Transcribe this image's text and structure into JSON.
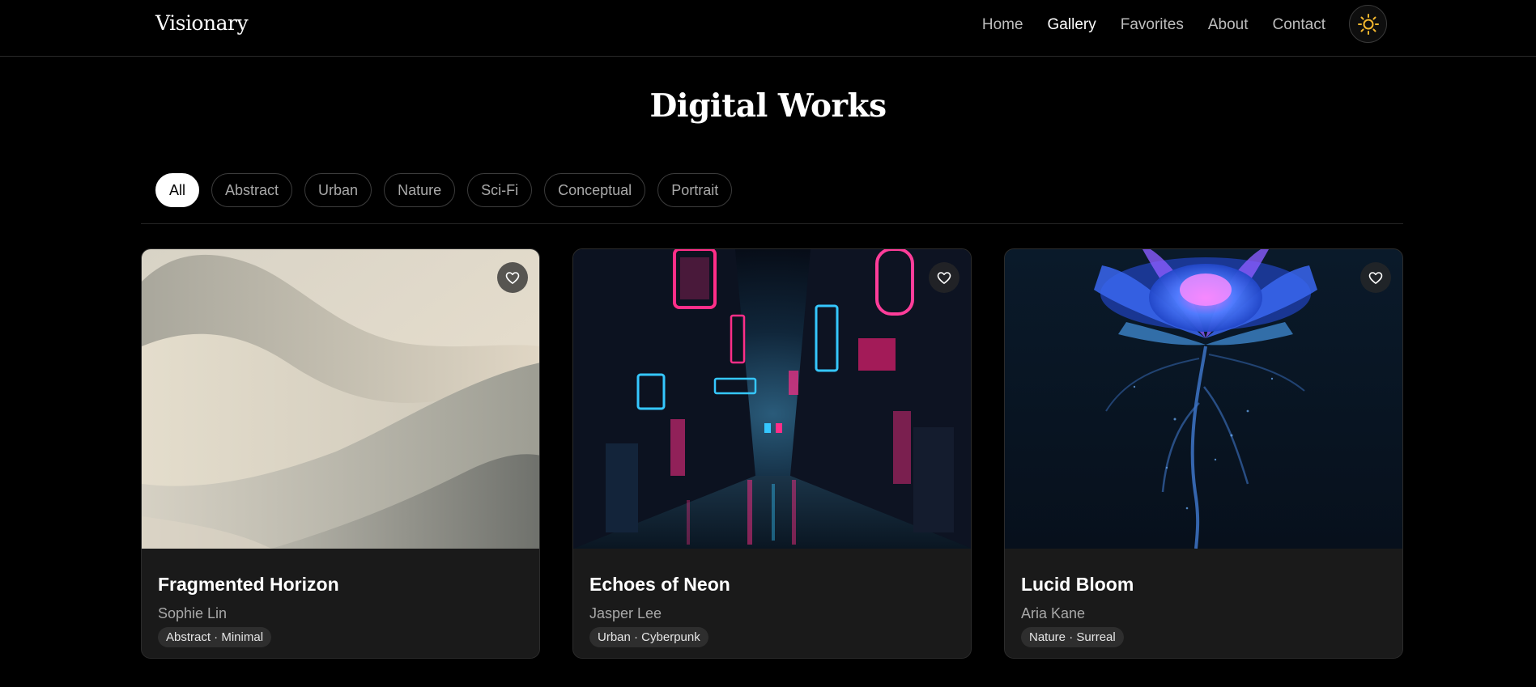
{
  "header": {
    "logo": "Visionary",
    "nav": [
      {
        "label": "Home",
        "active": false
      },
      {
        "label": "Gallery",
        "active": true
      },
      {
        "label": "Favorites",
        "active": false
      },
      {
        "label": "About",
        "active": false
      },
      {
        "label": "Contact",
        "active": false
      }
    ],
    "theme_icon": "sun-icon",
    "accent_color": "#f5b82e"
  },
  "page": {
    "title": "Digital Works"
  },
  "filters": [
    {
      "label": "All",
      "active": true
    },
    {
      "label": "Abstract",
      "active": false
    },
    {
      "label": "Urban",
      "active": false
    },
    {
      "label": "Nature",
      "active": false
    },
    {
      "label": "Sci-Fi",
      "active": false
    },
    {
      "label": "Conceptual",
      "active": false
    },
    {
      "label": "Portrait",
      "active": false
    }
  ],
  "artworks": [
    {
      "title": "Fragmented Horizon",
      "artist": "Sophie Lin",
      "tags": "Abstract · Minimal",
      "favorite_icon": "heart-outline-icon"
    },
    {
      "title": "Echoes of Neon",
      "artist": "Jasper Lee",
      "tags": "Urban · Cyberpunk",
      "favorite_icon": "heart-outline-icon"
    },
    {
      "title": "Lucid Bloom",
      "artist": "Aria Kane",
      "tags": "Nature · Surreal",
      "favorite_icon": "heart-outline-icon"
    }
  ]
}
